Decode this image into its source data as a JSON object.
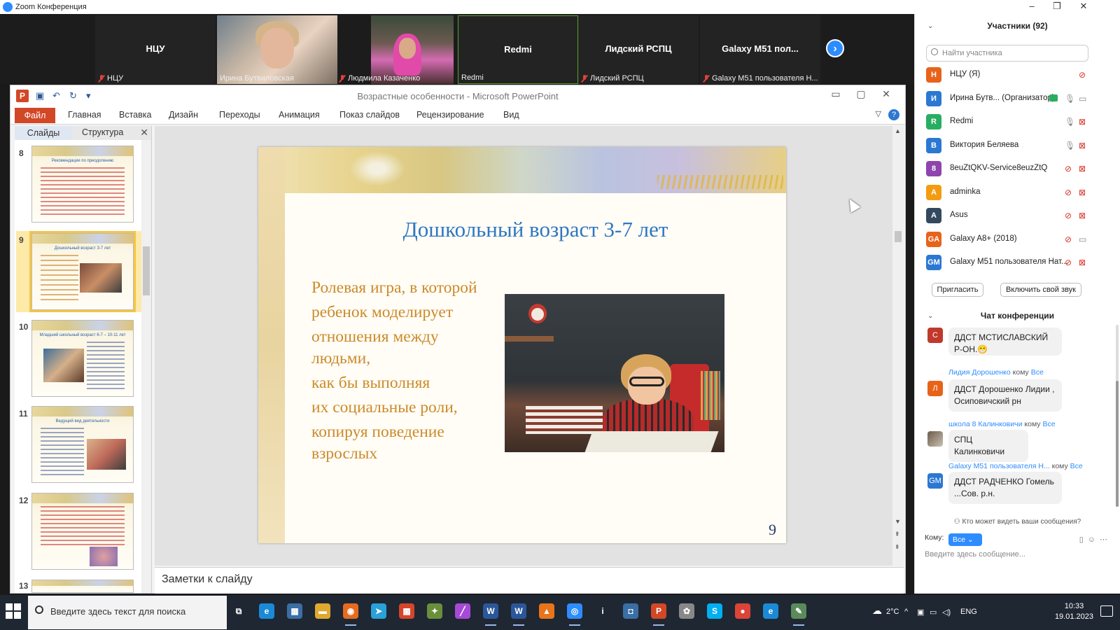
{
  "zoom_window": {
    "title": "Zoom Конференция"
  },
  "video_strip": {
    "tiles": [
      {
        "display": "НЦУ",
        "caption": "НЦУ"
      },
      {
        "display": "",
        "caption": "Ирина Бутвиловская"
      },
      {
        "display": "",
        "caption": "Людмила Казаченко"
      },
      {
        "display": "Redmi",
        "caption": "Redmi"
      },
      {
        "display": "Лидский РСПЦ",
        "caption": "Лидский РСПЦ"
      },
      {
        "display": "Galaxy M51 пол...",
        "caption": "Galaxy M51 пользователя Н..."
      }
    ]
  },
  "powerpoint": {
    "title": "Возрастные особенности  -  Microsoft PowerPoint",
    "ribbon_tabs": [
      "Файл",
      "Главная",
      "Вставка",
      "Дизайн",
      "Переходы",
      "Анимация",
      "Показ слайдов",
      "Рецензирование",
      "Вид"
    ],
    "panel_tabs": [
      "Слайды",
      "Структура"
    ],
    "thumbnails": [
      {
        "num": "8",
        "title": "Рекомендации по преодолению"
      },
      {
        "num": "9",
        "title": "Дошкольный возраст 3-7 лет"
      },
      {
        "num": "10",
        "title": "Младший школьный возраст 6-7 – 10-11 лет"
      },
      {
        "num": "11",
        "title": "Ведущий вид деятельности"
      },
      {
        "num": "12",
        "title": ""
      },
      {
        "num": "13",
        "title": ""
      }
    ],
    "slide": {
      "title": "Дошкольный возраст 3-7 лет",
      "text_lines": [
        "Ролевая игра, в которой",
        "ребенок моделирует",
        "отношения между людьми,",
        "как бы выполняя",
        "их социальные роли,",
        "копируя поведение взрослых"
      ],
      "page_number": "9"
    },
    "notes_placeholder": "Заметки к слайду"
  },
  "participants": {
    "header": "Участники (92)",
    "search_placeholder": "Найти участника",
    "list": [
      {
        "initial": "Н",
        "name": "НЦУ (Я)",
        "color": "#e8631a"
      },
      {
        "initial": "И",
        "name": "Ирина Бутв... (Организатор)",
        "color": "#2b78d3"
      },
      {
        "initial": "R",
        "name": "Redmi",
        "color": "#27ae60"
      },
      {
        "initial": "В",
        "name": "Виктория Беляева",
        "color": "#2b78d3"
      },
      {
        "initial": "8",
        "name": "8euZtQKV-Service8euzZtQ",
        "color": "#8e44ad"
      },
      {
        "initial": "A",
        "name": "adminka",
        "color": "#f39c12"
      },
      {
        "initial": "A",
        "name": "Asus",
        "color": "#34495e"
      },
      {
        "initial": "GA",
        "name": "Galaxy A8+ (2018)",
        "color": "#e8631a"
      },
      {
        "initial": "GM",
        "name": "Galaxy M51 пользователя Нат...",
        "color": "#2b78d3"
      }
    ],
    "invite_label": "Пригласить",
    "unmute_label": "Включить свой звук"
  },
  "chat": {
    "header": "Чат конференции",
    "to_word": "кому",
    "to_all": "Все",
    "messages": [
      {
        "from": "",
        "initial": "С",
        "color": "#c0392b",
        "text": "ДДСТ МСТИСЛАВСКИЙ Р-ОН.😁"
      },
      {
        "from": "Лидия Дорошенко",
        "initial": "Л",
        "color": "#e8631a",
        "text": "ДДСТ Дорошенко Лидии , Осиповичский рн"
      },
      {
        "from": "школа 8 Калинковичи",
        "initial": "",
        "color": "#6b5a4a",
        "text": "СПЦ Калинковичи"
      },
      {
        "from": "Galaxy M51 пользователя Н...",
        "initial": "GM",
        "color": "#2b78d3",
        "text": "ДДСТ РАДЧЕНКО  Гомель ...Сов. р.н."
      }
    ],
    "who_can_see": "Кто может видеть ваши сообщения?",
    "to_label": "Кому:",
    "to_value": "Все",
    "input_placeholder": "Введите здесь сообщение..."
  },
  "taskbar": {
    "search_placeholder": "Введите здесь текст для поиска",
    "weather": "2°C",
    "lang": "ENG",
    "time": "10:33",
    "date": "19.01.2023"
  }
}
